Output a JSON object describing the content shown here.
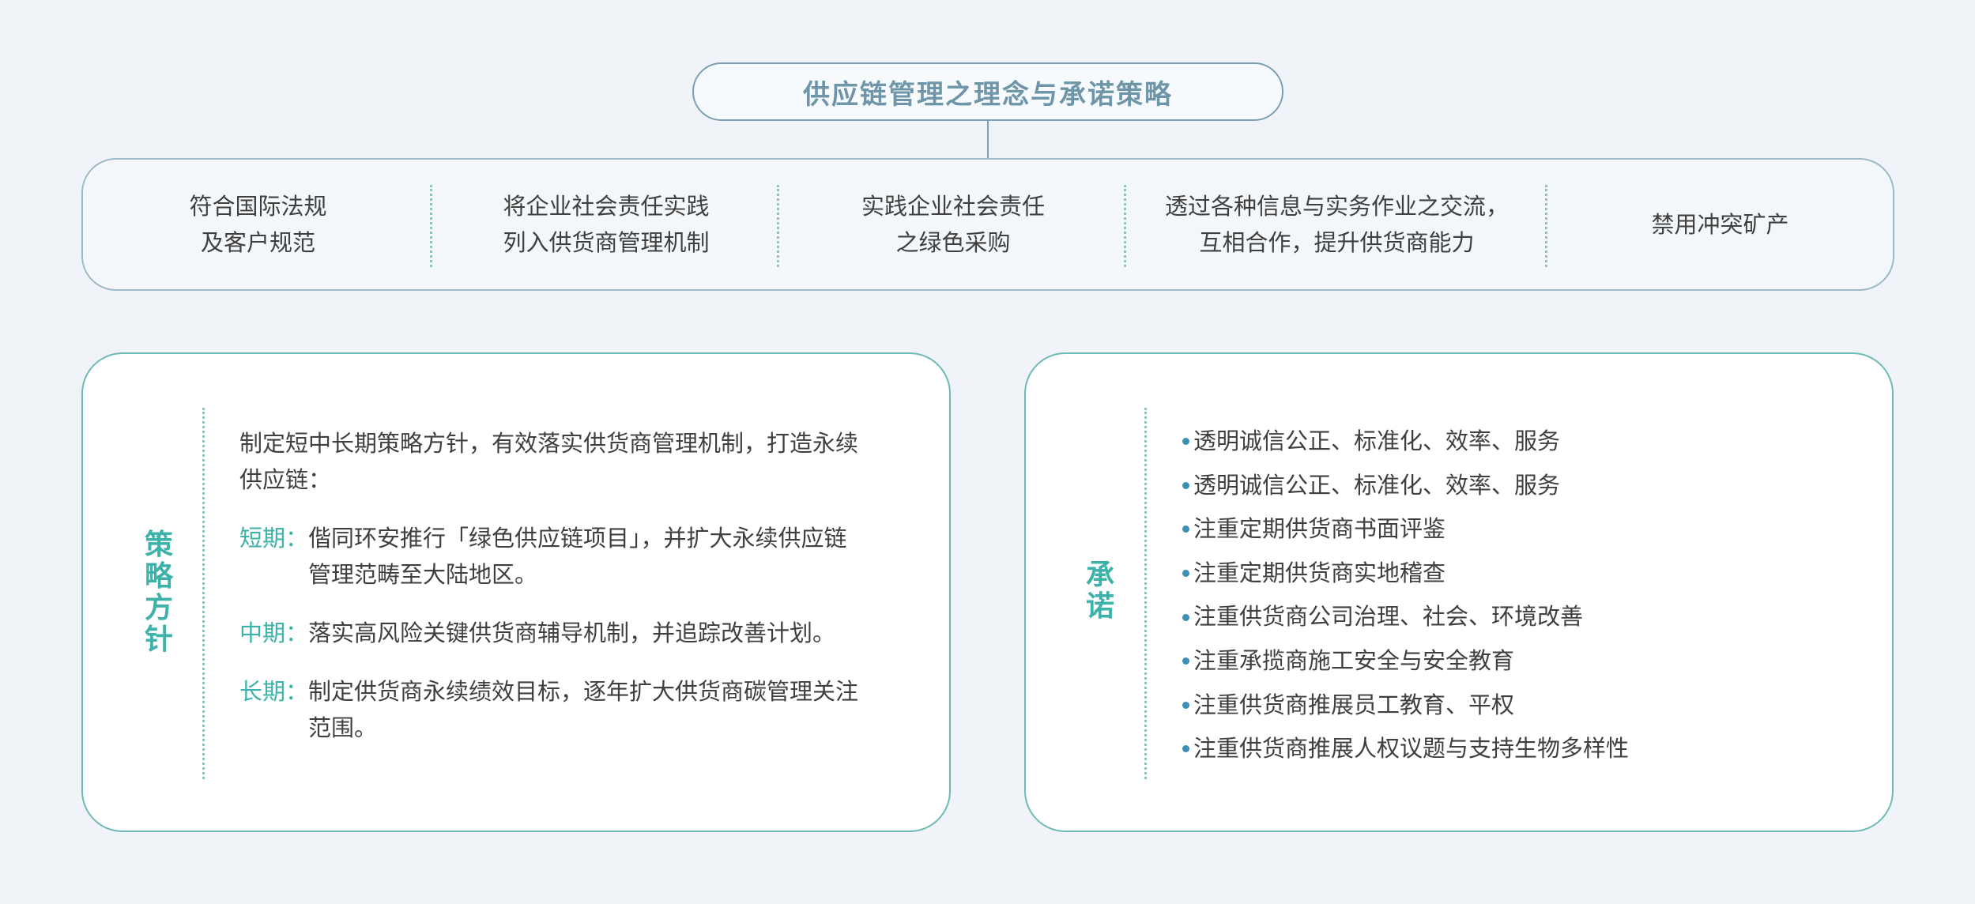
{
  "title": "供应链管理之理念与承诺策略",
  "principles": [
    {
      "line1": "符合国际法规",
      "line2": "及客户规范"
    },
    {
      "line1": "将企业社会责任实践",
      "line2": "列入供货商管理机制"
    },
    {
      "line1": "实践企业社会责任",
      "line2": "之绿色采购"
    },
    {
      "line1": "透过各种信息与实务作业之交流，",
      "line2": "互相合作，提升供货商能力"
    },
    {
      "line1": "禁用冲突矿产",
      "line2": ""
    }
  ],
  "strategy": {
    "label_chars": [
      "策",
      "略",
      "方",
      "针"
    ],
    "intro_line1": "制定短中长期策略方针，有效落实供货商管理机制，打造永续",
    "intro_line2": "供应链：",
    "terms": [
      {
        "label": "短期：",
        "line1": "偕同环安推行「绿色供应链项目」，并扩大永续供应链",
        "line2": "管理范畴至大陆地区。"
      },
      {
        "label": "中期：",
        "line1": "落实高风险关键供货商辅导机制，并追踪改善计划。",
        "line2": ""
      },
      {
        "label": "长期：",
        "line1": "制定供货商永续绩效目标，逐年扩大供货商碳管理关注",
        "line2": "范围。"
      }
    ]
  },
  "commitment": {
    "label_chars": [
      "承",
      "诺"
    ],
    "items": [
      "透明诚信公正、标准化、效率、服务",
      "透明诚信公正、标准化、效率、服务",
      "注重定期供货商书面评鉴",
      "注重定期供货商实地稽查",
      "注重供货商公司治理、社会、环境改善",
      "注重承揽商施工安全与安全教育",
      "注重供货商推展员工教育、平权",
      "注重供货商推展人权议题与支持生物多样性"
    ]
  },
  "colors": {
    "background": "#f0f4f8",
    "title_text": "#6f95a9",
    "accent_teal": "#3cb2a8",
    "bullet_blue": "#3c8fb2",
    "border_blue": "#7d9fb4"
  }
}
